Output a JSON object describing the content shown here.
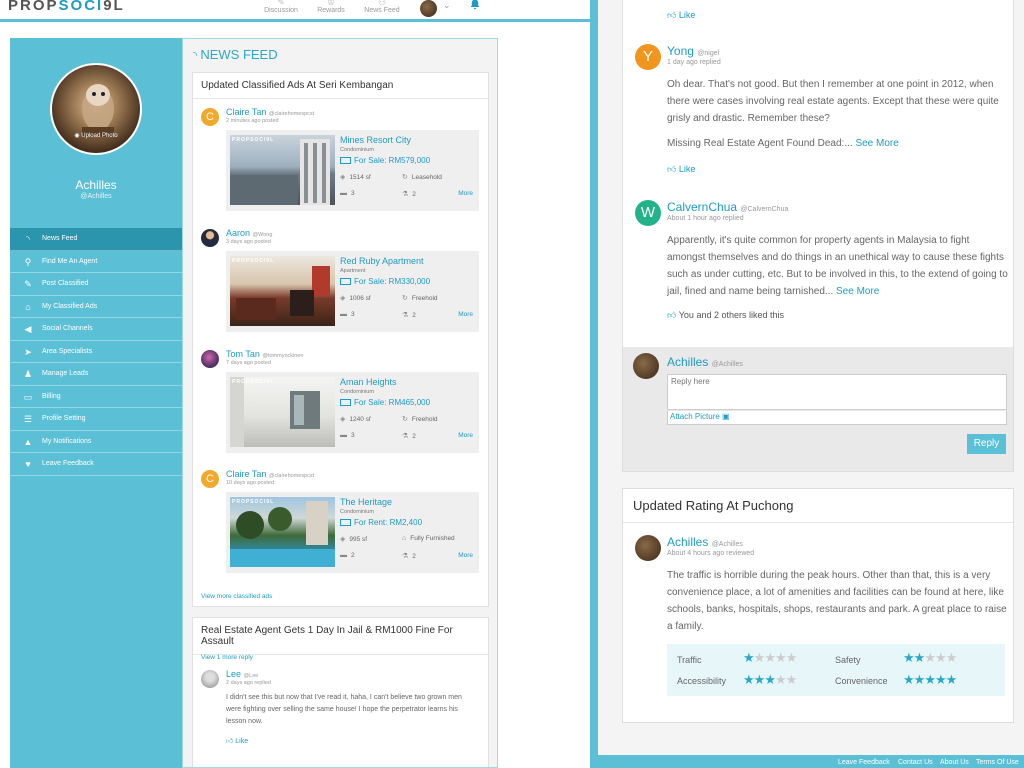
{
  "app": {
    "logo_prefix": "PROP",
    "logo_accent": "SOCI",
    "logo_suffix": "9L",
    "brand_color": "#5bc0d6",
    "link_color": "#1e9bc4"
  },
  "topnav": {
    "items": [
      {
        "label": "Discussion",
        "icon": "chat-icon"
      },
      {
        "label": "Rewards",
        "icon": "trophy-icon"
      },
      {
        "label": "News Feed",
        "icon": "people-icon"
      }
    ],
    "caret": "⌄"
  },
  "profile": {
    "upload_label": "Upload Photo",
    "name": "Achilles",
    "handle": "@Achilles"
  },
  "sidebar": {
    "items": [
      {
        "label": "News Feed",
        "icon": "rss-icon"
      },
      {
        "label": "Find Me An Agent",
        "icon": "search-user-icon"
      },
      {
        "label": "Post Classified",
        "icon": "edit-icon"
      },
      {
        "label": "My Classified Ads",
        "icon": "home-icon"
      },
      {
        "label": "Social Channels",
        "icon": "megaphone-icon"
      },
      {
        "label": "Area Specialists",
        "icon": "location-arrow-icon"
      },
      {
        "label": "Manage Leads",
        "icon": "users-icon"
      },
      {
        "label": "Billing",
        "icon": "credit-card-icon"
      },
      {
        "label": "Profile Setting",
        "icon": "settings-icon"
      },
      {
        "label": "My Notifications",
        "icon": "bell-icon"
      },
      {
        "label": "Leave Feedback",
        "icon": "heart-icon"
      }
    ]
  },
  "feed": {
    "title": "NEWS FEED",
    "classified_card": {
      "title": "Updated Classified Ads At Seri Kembangan",
      "posts": [
        {
          "name": "Claire Tan",
          "handle": "@clairehomespcst",
          "time": "2 minutes ago posted",
          "avatar": "C",
          "avatar_color": "#f0a92c",
          "listing": {
            "watermark": "PROPSOCI9L",
            "title": "Mines Resort City",
            "type": "Condominium",
            "price": "For Sale: RM579,000",
            "size": "1514 sf",
            "tenure": "Leasehold",
            "beds": "3",
            "baths": "2",
            "more": "More"
          }
        },
        {
          "name": "Aaron",
          "handle": "@Wong",
          "time": "3 days ago posted",
          "avatar": "",
          "avatar_color": "#4a3a30",
          "listing": {
            "watermark": "PROPSOCI9L",
            "title": "Red Ruby Apartment",
            "type": "Apartment",
            "price": "For Sale: RM330,000",
            "size": "1006 sf",
            "tenure": "Freehold",
            "beds": "3",
            "baths": "2",
            "more": "More"
          }
        },
        {
          "name": "Tom Tan",
          "handle": "@tommynckinen",
          "time": "7 days ago posted",
          "avatar": "",
          "avatar_color": "#8a4d6a",
          "listing": {
            "watermark": "PROPSOCI9L",
            "title": "Aman Heights",
            "type": "Condominium",
            "price": "For Sale: RM465,000",
            "size": "1240 sf",
            "tenure": "Freehold",
            "beds": "3",
            "baths": "2",
            "more": "More"
          }
        },
        {
          "name": "Claire Tan",
          "handle": "@clairehomespcst",
          "time": "10 days ago posted",
          "avatar": "C",
          "avatar_color": "#f0a92c",
          "listing": {
            "watermark": "PROPSOCI9L",
            "title": "The Heritage",
            "type": "Condominium",
            "price": "For Rent: RM2,400",
            "size": "995 sf",
            "tenure": "Fully Furnished",
            "beds": "2",
            "baths": "2",
            "more": "More"
          }
        }
      ],
      "view_more": "View more classified ads"
    },
    "article_card": {
      "title": "Real Estate Agent Gets 1 Day In Jail & RM1000 Fine For Assault",
      "view_reply": "View 1 more reply",
      "comment": {
        "name": "Lee",
        "handle": "@Lee",
        "time": "2 days ago replied",
        "text": "I didn't see this but now that I've read it, haha, I can't believe two grown men were fighting over selling the same house! I hope the perpetrator learns his lesson now.",
        "like": "Like"
      }
    }
  },
  "discussion": {
    "top_like": "Like",
    "comments": [
      {
        "name": "Yong",
        "handle": "@nigel",
        "time": "1 day ago replied",
        "avatar": "Y",
        "avatar_color": "#f0961e",
        "text": "Oh dear. That's not good. But then I remember at one point in 2012, when there were cases involving real estate agents. Except that these were quite grisly and drastic. Remember these?",
        "link_text": "Missing Real Estate Agent Found Dead:...",
        "see_more": "See More",
        "like": "Like"
      },
      {
        "name": "CalvernChua",
        "handle": "@CalvernChua",
        "time": "About 1 hour ago replied",
        "avatar": "W",
        "avatar_color": "#22b38a",
        "text": "Apparently, it's quite common for property agents in Malaysia to fight amongst themselves and do things in an unethical way to cause these fights such as under cutting, etc. But to be involved in this, to the extend of going to jail, fined and name being tarnished...",
        "see_more": "See More",
        "like": "You and 2 others liked this"
      }
    ],
    "reply": {
      "name": "Achilles",
      "handle": "@Achilles",
      "placeholder": "Reply here",
      "attach": "Attach Picture",
      "button": "Reply"
    }
  },
  "rating_card": {
    "title": "Updated Rating At Puchong",
    "name": "Achilles",
    "handle": "@Achilles",
    "time": "About 4 hours ago reviewed",
    "text": "The traffic is horrible during the peak hours. Other than that, this is a very convenience place, a lot of amenities and facilities can be found at here, like schools, banks, hospitals, shops, restaurants and park. A great place to raise a family.",
    "ratings": [
      {
        "label": "Traffic",
        "stars": 1
      },
      {
        "label": "Safety",
        "stars": 2
      },
      {
        "label": "Accessibility",
        "stars": 3
      },
      {
        "label": "Convenience",
        "stars": 5
      }
    ]
  },
  "footer": {
    "links": [
      "Leave Feedback",
      "Contact Us",
      "About Us",
      "Terms Of Use"
    ]
  }
}
